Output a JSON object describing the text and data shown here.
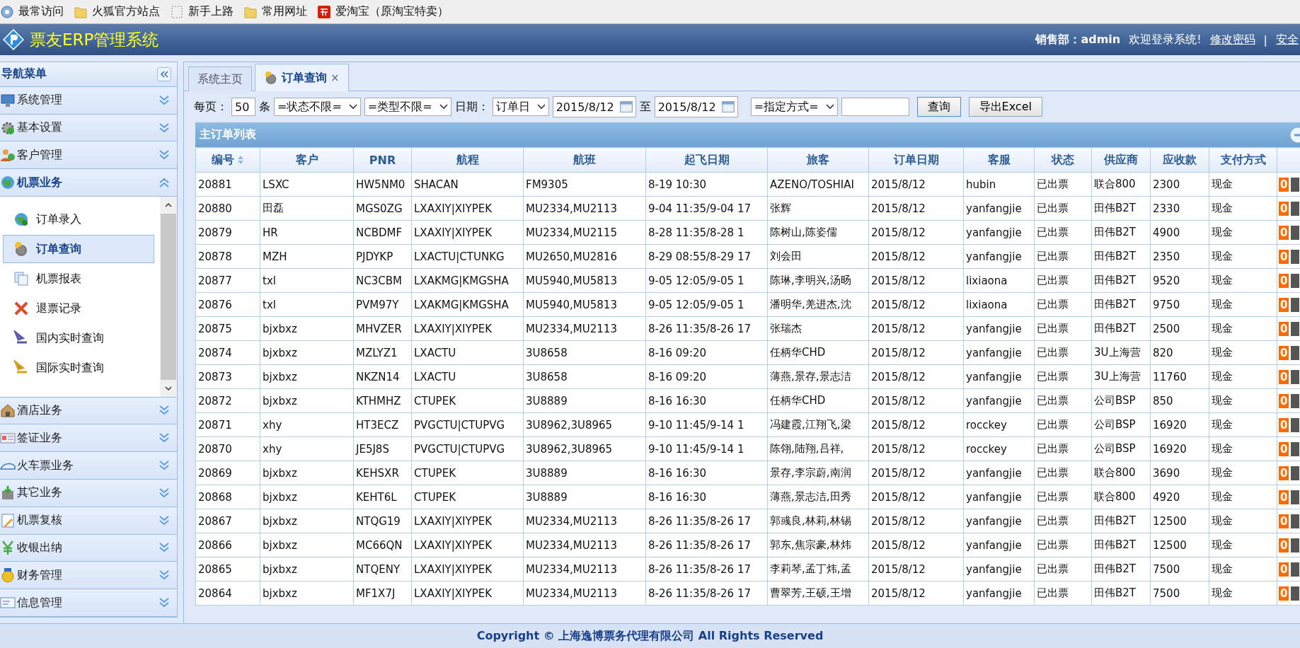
{
  "bookmarks": [
    {
      "label": "最常访问",
      "kind": "recent"
    },
    {
      "label": "火狐官方站点",
      "kind": "folder"
    },
    {
      "label": "新手上路",
      "kind": "blank"
    },
    {
      "label": "常用网址",
      "kind": "folder"
    },
    {
      "label": "爱淘宝（原淘宝特卖）",
      "kind": "taobao"
    }
  ],
  "header": {
    "title": "票友ERP管理系统",
    "user": "销售部：admin",
    "welcome": "欢迎登录系统!",
    "links": [
      "修改密码",
      "安全"
    ],
    "separator": "|"
  },
  "sidebar": {
    "title": "导航菜单",
    "sections": [
      {
        "label": "系统管理",
        "expanded": false
      },
      {
        "label": "基本设置",
        "expanded": false
      },
      {
        "label": "客户管理",
        "expanded": false
      },
      {
        "label": "机票业务",
        "expanded": true,
        "items": [
          {
            "label": "订单录入",
            "selected": false
          },
          {
            "label": "订单查询",
            "selected": true
          },
          {
            "label": "机票报表",
            "selected": false
          },
          {
            "label": "退票记录",
            "selected": false
          },
          {
            "label": "国内实时查询",
            "selected": false
          },
          {
            "label": "国际实时查询",
            "selected": false
          }
        ]
      },
      {
        "label": "酒店业务",
        "expanded": false
      },
      {
        "label": "签证业务",
        "expanded": false
      },
      {
        "label": "火车票业务",
        "expanded": false
      },
      {
        "label": "其它业务",
        "expanded": false
      },
      {
        "label": "机票复核",
        "expanded": false
      },
      {
        "label": "收银出纳",
        "expanded": false
      },
      {
        "label": "财务管理",
        "expanded": false
      },
      {
        "label": "信息管理",
        "expanded": false
      }
    ]
  },
  "tabs": [
    {
      "label": "系统主页",
      "selected": false
    },
    {
      "label": "订单查询",
      "selected": true,
      "close": "×"
    }
  ],
  "toolbar": {
    "per_page_label": "每页：",
    "per_page": "50",
    "per_page_unit": "条",
    "status_select": "=状态不限=",
    "type_select": "=类型不限=",
    "date_label": "日期：",
    "date_type": "订单日",
    "date_from": "2015/8/12",
    "to_label": "至",
    "date_to": "2015/8/12",
    "mode_select": "=指定方式=",
    "search_button": "查询",
    "export_button": "导出Excel"
  },
  "table": {
    "title": "主订单列表",
    "columns": [
      "编号",
      "客户",
      "PNR",
      "航程",
      "航班",
      "起飞日期",
      "旅客",
      "订单日期",
      "客服",
      "状态",
      "供应商",
      "应收款",
      "支付方式"
    ],
    "rows": [
      [
        "20881",
        "LSXC",
        "HW5NM0",
        "SHACAN",
        "FM9305",
        "8-19 10:30",
        "AZENO/TOSHIAI",
        "2015/8/12",
        "hubin",
        "已出票",
        "联合800",
        "2300",
        "现金",
        "0"
      ],
      [
        "20880",
        "田磊",
        "MGS0ZG",
        "LXAXIY|XIYPEK",
        "MU2334,MU2113",
        "9-04 11:35/9-04 17",
        "张辉",
        "2015/8/12",
        "yanfangjie",
        "已出票",
        "田伟B2T",
        "2330",
        "现金",
        "0"
      ],
      [
        "20879",
        "HR",
        "NCBDMF",
        "LXAXIY|XIYPEK",
        "MU2334,MU2115",
        "8-28 11:35/8-28 1",
        "陈树山,陈姿儒",
        "2015/8/12",
        "yanfangjie",
        "已出票",
        "田伟B2T",
        "4900",
        "现金",
        "0"
      ],
      [
        "20878",
        "MZH",
        "PJDYKP",
        "LXACTU|CTUNKG",
        "MU2650,MU2816",
        "8-29 08:55/8-29 17",
        "刘会田",
        "2015/8/12",
        "yanfangjie",
        "已出票",
        "田伟B2T",
        "2350",
        "现金",
        "0"
      ],
      [
        "20877",
        "txl",
        "NC3CBM",
        "LXAKMG|KMGSHA",
        "MU5940,MU5813",
        "9-05 12:05/9-05 1",
        "陈琳,李明兴,汤旸",
        "2015/8/12",
        "lixiaona",
        "已出票",
        "田伟B2T",
        "9520",
        "现金",
        "0"
      ],
      [
        "20876",
        "txl",
        "PVM97Y",
        "LXAKMG|KMGSHA",
        "MU5940,MU5813",
        "9-05 12:05/9-05 1",
        "潘明华,羌进杰,沈",
        "2015/8/12",
        "lixiaona",
        "已出票",
        "田伟B2T",
        "9750",
        "现金",
        "0"
      ],
      [
        "20875",
        "bjxbxz",
        "MHVZER",
        "LXAXIY|XIYPEK",
        "MU2334,MU2113",
        "8-26 11:35/8-26 17",
        "张瑞杰",
        "2015/8/12",
        "yanfangjie",
        "已出票",
        "田伟B2T",
        "2500",
        "现金",
        "0"
      ],
      [
        "20874",
        "bjxbxz",
        "MZLYZ1",
        "LXACTU",
        "3U8658",
        "8-16 09:20",
        "任柄华CHD",
        "2015/8/12",
        "yanfangjie",
        "已出票",
        "3U上海营",
        "820",
        "现金",
        "0"
      ],
      [
        "20873",
        "bjxbxz",
        "NKZN14",
        "LXACTU",
        "3U8658",
        "8-16 09:20",
        "薄燕,景存,景志洁",
        "2015/8/12",
        "yanfangjie",
        "已出票",
        "3U上海营",
        "11760",
        "现金",
        "0"
      ],
      [
        "20872",
        "bjxbxz",
        "KTHMHZ",
        "CTUPEK",
        "3U8889",
        "8-16 16:30",
        "任柄华CHD",
        "2015/8/12",
        "yanfangjie",
        "已出票",
        "公司BSP",
        "850",
        "现金",
        "0"
      ],
      [
        "20871",
        "xhy",
        "HT3ECZ",
        "PVGCTU|CTUPVG",
        "3U8962,3U8965",
        "9-10 11:45/9-14 1",
        "冯建霞,江翔飞,梁",
        "2015/8/12",
        "rocckey",
        "已出票",
        "公司BSP",
        "16920",
        "现金",
        "0"
      ],
      [
        "20870",
        "xhy",
        "JE5J8S",
        "PVGCTU|CTUPVG",
        "3U8962,3U8965",
        "9-10 11:45/9-14 1",
        "陈翎,陆翔,吕祥,",
        "2015/8/12",
        "rocckey",
        "已出票",
        "公司BSP",
        "16920",
        "现金",
        "0"
      ],
      [
        "20869",
        "bjxbxz",
        "KEHSXR",
        "CTUPEK",
        "3U8889",
        "8-16 16:30",
        "景存,李宗蔚,南润",
        "2015/8/12",
        "yanfangjie",
        "已出票",
        "联合800",
        "3690",
        "现金",
        "0"
      ],
      [
        "20868",
        "bjxbxz",
        "KEHT6L",
        "CTUPEK",
        "3U8889",
        "8-16 16:30",
        "薄燕,景志洁,田秀",
        "2015/8/12",
        "yanfangjie",
        "已出票",
        "联合800",
        "4920",
        "现金",
        "0"
      ],
      [
        "20867",
        "bjxbxz",
        "NTQG19",
        "LXAXIY|XIYPEK",
        "MU2334,MU2113",
        "8-26 11:35/8-26 17",
        "郭彧良,林莉,林锡",
        "2015/8/12",
        "yanfangjie",
        "已出票",
        "田伟B2T",
        "12500",
        "现金",
        "0"
      ],
      [
        "20866",
        "bjxbxz",
        "MC66QN",
        "LXAXIY|XIYPEK",
        "MU2334,MU2113",
        "8-26 11:35/8-26 17",
        "郭东,焦宗豪,林炜",
        "2015/8/12",
        "yanfangjie",
        "已出票",
        "田伟B2T",
        "12500",
        "现金",
        "0"
      ],
      [
        "20865",
        "bjxbxz",
        "NTQENY",
        "LXAXIY|XIYPEK",
        "MU2334,MU2113",
        "8-26 11:35/8-26 17",
        "李莉琴,孟丁炜,孟",
        "2015/8/12",
        "yanfangjie",
        "已出票",
        "田伟B2T",
        "7500",
        "现金",
        "0"
      ],
      [
        "20864",
        "bjxbxz",
        "MF1X7J",
        "LXAXIY|XIYPEK",
        "MU2334,MU2113",
        "8-26 11:35/8-26 17",
        "曹翠芳,王硕,王增",
        "2015/8/12",
        "yanfangjie",
        "已出票",
        "田伟B2T",
        "7500",
        "现金",
        "0"
      ]
    ]
  },
  "footer": {
    "copyright": "Copyright © 上海逸博票务代理有限公司 All Rights Reserved"
  }
}
